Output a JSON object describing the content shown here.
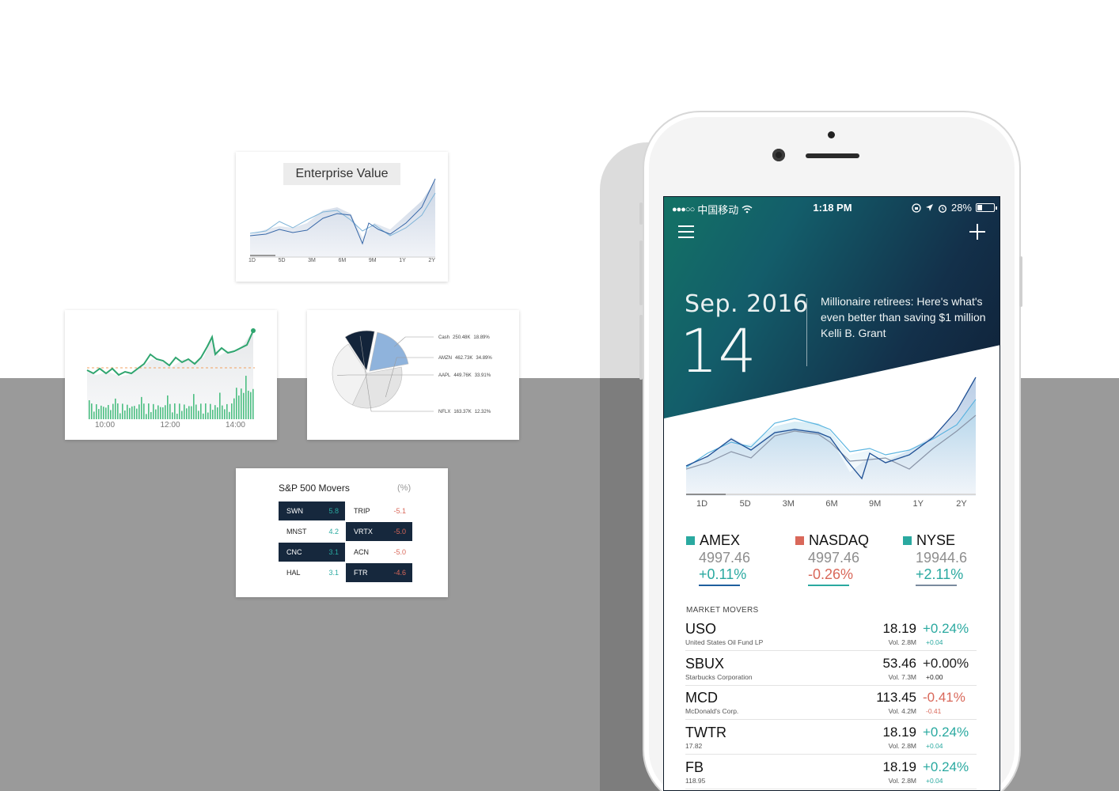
{
  "colors": {
    "teal": "#2aa9a0",
    "red": "#d9685a",
    "navy": "#16283d",
    "green_line": "#2fa56f",
    "light_blue": "#8fb3dc"
  },
  "cards": {
    "enterprise_value": {
      "title": "Enterprise Value",
      "ranges": [
        "1D",
        "5D",
        "3M",
        "6M",
        "9M",
        "1Y",
        "2Y"
      ]
    },
    "intraday": {
      "times": [
        "10:00",
        "12:00",
        "14:00"
      ]
    },
    "pie": {
      "slices": [
        {
          "label": "Cash",
          "amount": "250.48K",
          "pct": "18.89%",
          "value": 18.89,
          "color": "#8fb3dc"
        },
        {
          "label": "AMZN",
          "amount": "462.73K",
          "pct": "34.89%",
          "value": 34.89,
          "color": "#e4e4e4"
        },
        {
          "label": "AAPL",
          "amount": "449.76K",
          "pct": "33.91%",
          "value": 33.91,
          "color": "#f2f2f2"
        },
        {
          "label": "NFLX",
          "amount": "163.37K",
          "pct": "12.32%",
          "value": 12.32,
          "color": "#13243a"
        }
      ]
    },
    "sp500": {
      "title": "S&P 500 Movers",
      "unit": "(%)",
      "rows": [
        {
          "left": {
            "ticker": "SWN",
            "value": "5.8",
            "style": "dark"
          },
          "right": {
            "ticker": "TRIP",
            "value": "-5.1",
            "style": "light"
          }
        },
        {
          "left": {
            "ticker": "MNST",
            "value": "4.2",
            "style": "light"
          },
          "right": {
            "ticker": "VRTX",
            "value": "-5.0",
            "style": "dark"
          }
        },
        {
          "left": {
            "ticker": "CNC",
            "value": "3.1",
            "style": "dark"
          },
          "right": {
            "ticker": "ACN",
            "value": "-5.0",
            "style": "light"
          }
        },
        {
          "left": {
            "ticker": "HAL",
            "value": "3.1",
            "style": "light"
          },
          "right": {
            "ticker": "FTR",
            "value": "-4.6",
            "style": "dark"
          }
        }
      ]
    }
  },
  "phone": {
    "status": {
      "carrier": "中国移动",
      "time": "1:18 PM",
      "battery": "28%"
    },
    "hero": {
      "month": "Sep. 2016",
      "day": "14",
      "headline": "Millionaire retirees: Here's what's even better than saving $1 million",
      "author": "Kelli B. Grant"
    },
    "ranges": [
      "1D",
      "5D",
      "3M",
      "6M",
      "9M",
      "1Y",
      "2Y"
    ],
    "indices": [
      {
        "name": "AMEX",
        "value": "4997.46",
        "change": "+0.11%",
        "color": "#2aa9a0",
        "change_color": "#2aa9a0",
        "bar_color": "#1f5f9e"
      },
      {
        "name": "NASDAQ",
        "value": "4997.46",
        "change": "-0.26%",
        "color": "#d9685a",
        "change_color": "#d9685a",
        "bar_color": "#2aa9a0"
      },
      {
        "name": "NYSE",
        "value": "19944.6",
        "change": "+2.11%",
        "color": "#2aa9a0",
        "change_color": "#2aa9a0",
        "bar_color": "#7a8a9e"
      }
    ],
    "movers_title": "MARKET MOVERS",
    "movers": [
      {
        "ticker": "USO",
        "company": "United States Oil Fund LP",
        "price": "18.19",
        "volume": "Vol. 2.8M",
        "pct": "+0.24%",
        "abs": "+0.04",
        "color": "#2aa9a0"
      },
      {
        "ticker": "SBUX",
        "company": "Starbucks Corporation",
        "price": "53.46",
        "volume": "Vol. 7.3M",
        "pct": "+0.00%",
        "abs": "+0.00",
        "color": "#222222"
      },
      {
        "ticker": "MCD",
        "company": "McDonald's Corp.",
        "price": "113.45",
        "volume": "Vol. 4.2M",
        "pct": "-0.41%",
        "abs": "-0.41",
        "color": "#d9685a"
      },
      {
        "ticker": "TWTR",
        "company": "17.82",
        "price": "18.19",
        "volume": "Vol. 2.8M",
        "pct": "+0.24%",
        "abs": "+0.04",
        "color": "#2aa9a0"
      },
      {
        "ticker": "FB",
        "company": "118.95",
        "price": "18.19",
        "volume": "Vol. 2.8M",
        "pct": "+0.24%",
        "abs": "+0.04",
        "color": "#2aa9a0"
      }
    ]
  }
}
